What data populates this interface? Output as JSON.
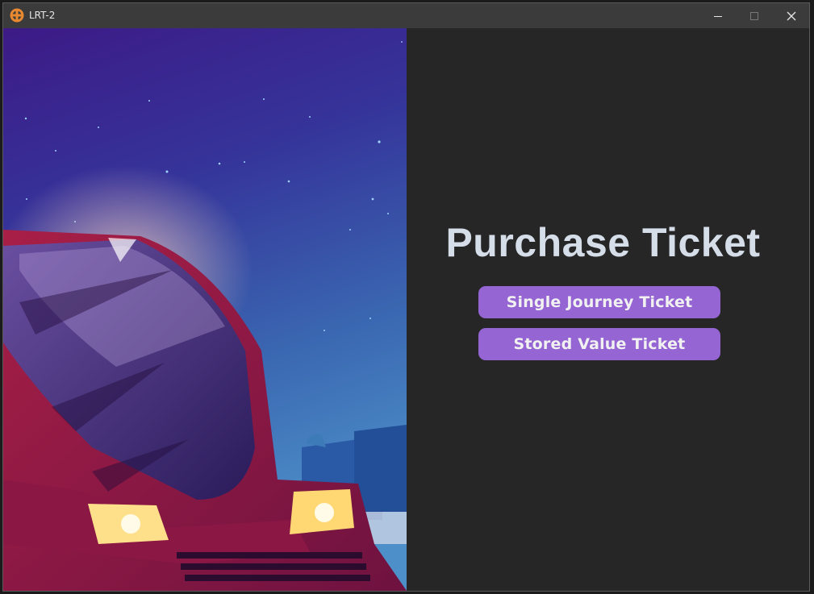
{
  "window": {
    "title": "LRT-2",
    "app_icon": "lrt-logo-icon",
    "controls": {
      "minimize_icon": "minimize-icon",
      "maximize_icon": "maximize-icon",
      "close_icon": "close-icon"
    }
  },
  "hero": {
    "image": "night-train-illustration"
  },
  "main": {
    "heading": "Purchase Ticket",
    "buttons": [
      {
        "label": "Single Journey Ticket"
      },
      {
        "label": "Stored Value Ticket"
      }
    ]
  },
  "colors": {
    "window_bg": "#262626",
    "titlebar_bg": "#3b3b3b",
    "heading": "#d5dde9",
    "button_bg": "#9565d3",
    "button_text": "#f1f1f1"
  }
}
